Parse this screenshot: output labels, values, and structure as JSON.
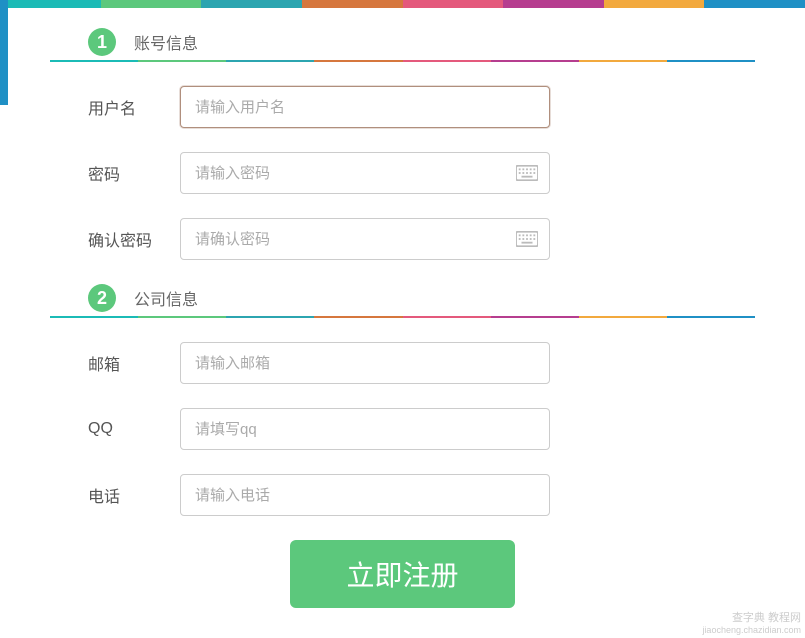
{
  "colors": {
    "rainbow": [
      "#1bbbb6",
      "#5cc87c",
      "#2ca5b0",
      "#d6773e",
      "#e4597c",
      "#b63d8f",
      "#f2a93e",
      "#1f90c5"
    ]
  },
  "sections": {
    "account": {
      "step": "1",
      "title": "账号信息"
    },
    "company": {
      "step": "2",
      "title": "公司信息"
    }
  },
  "fields": {
    "username": {
      "label": "用户名",
      "placeholder": "请输入用户名"
    },
    "password": {
      "label": "密码",
      "placeholder": "请输入密码"
    },
    "confirmPassword": {
      "label": "确认密码",
      "placeholder": "请确认密码"
    },
    "email": {
      "label": "邮箱",
      "placeholder": "请输入邮箱"
    },
    "qq": {
      "label": "QQ",
      "placeholder": "请填写qq"
    },
    "phone": {
      "label": "电话",
      "placeholder": "请输入电话"
    }
  },
  "submit": {
    "label": "立即注册"
  },
  "watermark": {
    "main": "查字典 教程网",
    "sub": "jiaocheng.chazidian.com"
  }
}
